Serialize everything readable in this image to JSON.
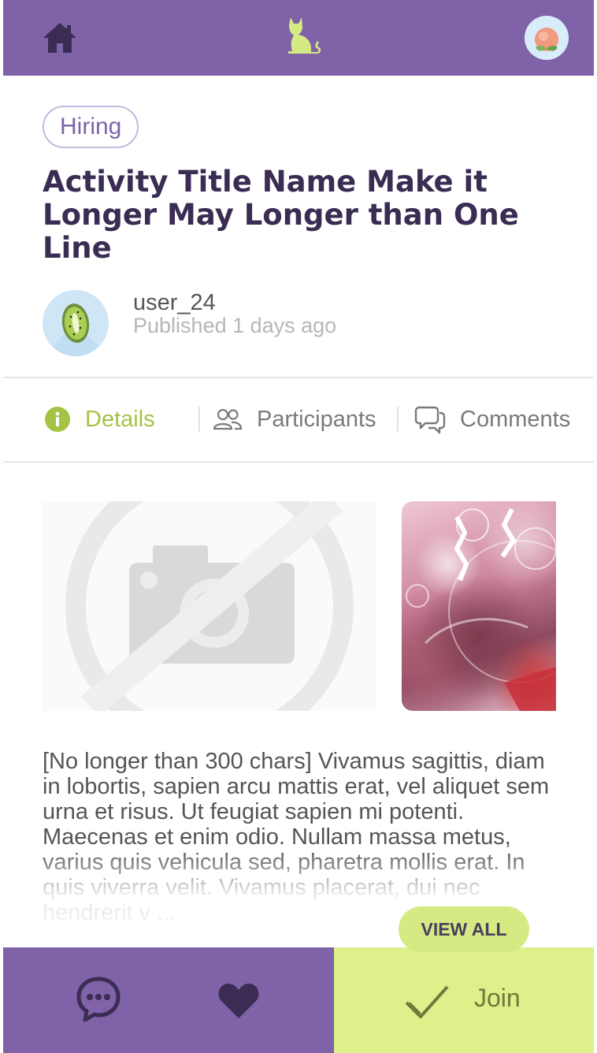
{
  "header": {
    "home_icon": "home-icon",
    "logo_icon": "cat-logo-icon",
    "avatar_icon": "peach-avatar-icon",
    "bg_color": "#7f62a8",
    "logo_color": "#d6ea84"
  },
  "activity": {
    "tag": "Hiring",
    "title": "Activity Title Name Make it Longer May Longer than One Line",
    "author": {
      "username": "user_24",
      "published": "Published 1 days ago",
      "avatar_icon": "kiwi-avatar-icon"
    }
  },
  "tabs": [
    {
      "label": "Details",
      "icon": "info-icon",
      "active": true
    },
    {
      "label": "Participants",
      "icon": "people-icon",
      "active": false
    },
    {
      "label": "Comments",
      "icon": "comments-icon",
      "active": false
    }
  ],
  "media": {
    "placeholder_icon": "no-camera-icon",
    "photo_icon": "abstract-pink-photo"
  },
  "description": {
    "text": "[No longer than 300 chars] Vivamus sagittis, diam in lobortis, sapien arcu mattis erat, vel aliquet sem urna et risus. Ut feugiat sapien mi potenti. Maecenas et enim odio. Nullam massa metus, varius quis vehicula sed, pharetra mollis erat. In quis viverra velit. Vivamus placerat, dui nec hendrerit v ...",
    "view_all_label": "VIEW ALL"
  },
  "bottom_bar": {
    "chat_icon": "chat-bubble-icon",
    "like_icon": "heart-icon",
    "join_icon": "check-icon",
    "join_label": "Join",
    "left_color": "#7f62a8",
    "join_color": "#def089"
  }
}
